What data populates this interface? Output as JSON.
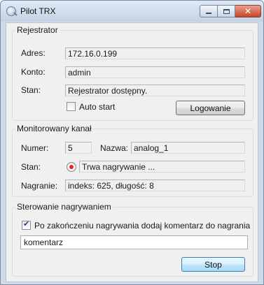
{
  "window": {
    "title": "Pilot TRX"
  },
  "recorder": {
    "legend": "Rejestrator",
    "address_label": "Adres:",
    "address_value": "172.16.0.199",
    "account_label": "Konto:",
    "account_value": "admin",
    "state_label": "Stan:",
    "state_value": "Rejestrator dostępny.",
    "autostart_label": "Auto start",
    "autostart_checked": false,
    "login_button": "Logowanie"
  },
  "channel": {
    "legend": "Monitorowany kanał",
    "number_label": "Numer:",
    "number_value": "5",
    "name_label": "Nazwa:",
    "name_value": "analog_1",
    "state_label": "Stan:",
    "state_icon": "record-icon",
    "state_value": "Trwa nagrywanie ...",
    "recording_label": "Nagranie:",
    "recording_value": "indeks: 625, długość: 8"
  },
  "control": {
    "legend": "Sterowanie nagrywaniem",
    "comment_checkbox_label": "Po zakończeniu nagrywania dodaj komentarz do nagrania",
    "comment_checkbox_checked": true,
    "comment_value": "komentarz",
    "stop_button": "Stop"
  }
}
